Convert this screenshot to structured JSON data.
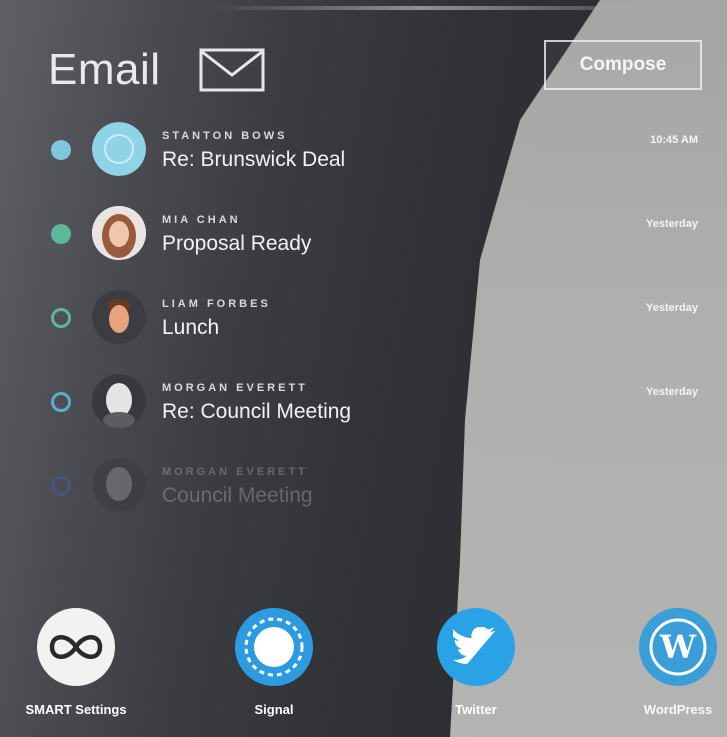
{
  "header": {
    "title": "Email",
    "compose_label": "Compose"
  },
  "emails": [
    {
      "sender": "STANTON BOWS",
      "subject": "Re: Brunswick Deal",
      "time": "10:45 AM",
      "dot": "filled",
      "dot_color": "#7ec8dd"
    },
    {
      "sender": "MIA CHAN",
      "subject": "Proposal Ready",
      "time": "Yesterday",
      "dot": "filled",
      "dot_color": "#5db79a"
    },
    {
      "sender": "LIAM FORBES",
      "subject": "Lunch",
      "time": "Yesterday",
      "dot": "outline",
      "dot_color": "#5db79a"
    },
    {
      "sender": "MORGAN EVERETT",
      "subject": "Re: Council Meeting",
      "time": "Yesterday",
      "dot": "outline",
      "dot_color": "#5aaed0"
    },
    {
      "sender": "MORGAN EVERETT",
      "subject": "Council Meeting",
      "time": "",
      "dot": "outline",
      "dot_color": "#3f5fa0"
    }
  ],
  "dock": {
    "apps": [
      {
        "label": "SMART Settings",
        "icon": "infinity-icon",
        "color": "#f2f2f2"
      },
      {
        "label": "Signal",
        "icon": "signal-icon",
        "color": "#2c9be0"
      },
      {
        "label": "Twitter",
        "icon": "twitter-icon",
        "color": "#2aa3e6"
      },
      {
        "label": "WordPress",
        "icon": "wordpress-icon",
        "color": "#3c9ed8"
      }
    ]
  }
}
